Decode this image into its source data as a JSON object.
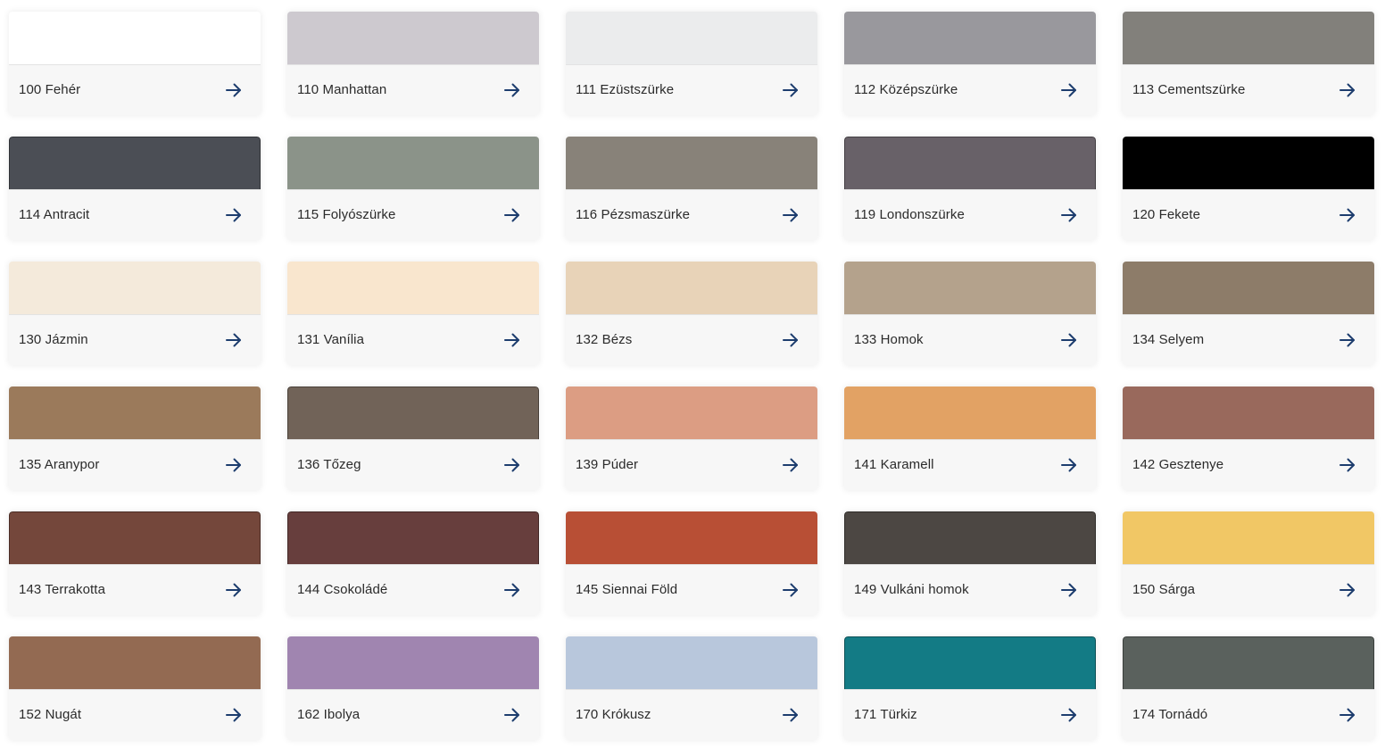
{
  "colors": {
    "arrow": "#1d3d6e",
    "card_background": "#f7f7f7"
  },
  "swatches": [
    {
      "label": "100 Fehér",
      "color": "#ffffff",
      "icon": "arrow-right-icon"
    },
    {
      "label": "110 Manhattan",
      "color": "#cdc9cf",
      "icon": "arrow-right-icon"
    },
    {
      "label": "111 Ezüstszürke",
      "color": "#ebeced",
      "icon": "arrow-right-icon"
    },
    {
      "label": "112 Középszürke",
      "color": "#99989d",
      "icon": "arrow-right-icon"
    },
    {
      "label": "113 Cementszürke",
      "color": "#82807b",
      "icon": "arrow-right-icon"
    },
    {
      "label": "114 Antracit",
      "color": "#4b4e55",
      "icon": "arrow-right-icon"
    },
    {
      "label": "115 Folyószürke",
      "color": "#8b9389",
      "icon": "arrow-right-icon"
    },
    {
      "label": "116 Pézsmaszürke",
      "color": "#888279",
      "icon": "arrow-right-icon"
    },
    {
      "label": "119 Londonszürke",
      "color": "#686168",
      "icon": "arrow-right-icon"
    },
    {
      "label": "120 Fekete",
      "color": "#000000",
      "icon": "arrow-right-icon"
    },
    {
      "label": "130 Jázmin",
      "color": "#f4eadb",
      "icon": "arrow-right-icon"
    },
    {
      "label": "131 Vanília",
      "color": "#f9e6ce",
      "icon": "arrow-right-icon"
    },
    {
      "label": "132 Bézs",
      "color": "#e8d3b8",
      "icon": "arrow-right-icon"
    },
    {
      "label": "133 Homok",
      "color": "#b4a28c",
      "icon": "arrow-right-icon"
    },
    {
      "label": "134 Selyem",
      "color": "#8d7c69",
      "icon": "arrow-right-icon"
    },
    {
      "label": "135 Aranypor",
      "color": "#9b7a5b",
      "icon": "arrow-right-icon"
    },
    {
      "label": "136 Tőzeg",
      "color": "#716358",
      "icon": "arrow-right-icon"
    },
    {
      "label": "139 Púder",
      "color": "#dc9d83",
      "icon": "arrow-right-icon"
    },
    {
      "label": "141 Karamell",
      "color": "#e2a264",
      "icon": "arrow-right-icon"
    },
    {
      "label": "142 Gesztenye",
      "color": "#99695c",
      "icon": "arrow-right-icon"
    },
    {
      "label": "143 Terrakotta",
      "color": "#74473b",
      "icon": "arrow-right-icon"
    },
    {
      "label": "144 Csokoládé",
      "color": "#673e3d",
      "icon": "arrow-right-icon"
    },
    {
      "label": "145 Siennai Föld",
      "color": "#b84f35",
      "icon": "arrow-right-icon"
    },
    {
      "label": "149 Vulkáni homok",
      "color": "#4c4743",
      "icon": "arrow-right-icon"
    },
    {
      "label": "150 Sárga",
      "color": "#f1c765",
      "icon": "arrow-right-icon"
    },
    {
      "label": "152 Nugát",
      "color": "#936a52",
      "icon": "arrow-right-icon"
    },
    {
      "label": "162 Ibolya",
      "color": "#a085b0",
      "icon": "arrow-right-icon"
    },
    {
      "label": "170 Krókusz",
      "color": "#b8c7dc",
      "icon": "arrow-right-icon"
    },
    {
      "label": "171 Türkiz",
      "color": "#137b85",
      "icon": "arrow-right-icon"
    },
    {
      "label": "174 Tornádó",
      "color": "#5a615d",
      "icon": "arrow-right-icon"
    }
  ]
}
